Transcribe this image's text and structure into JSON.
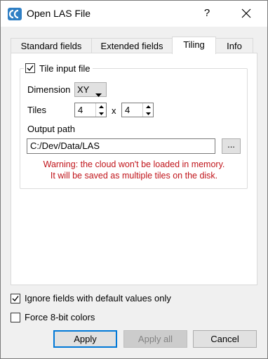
{
  "window": {
    "title": "Open LAS File",
    "help_label": "?"
  },
  "tabs": [
    {
      "label": "Standard fields",
      "active": false
    },
    {
      "label": "Extended fields",
      "active": false
    },
    {
      "label": "Tiling",
      "active": true
    },
    {
      "label": "Info",
      "active": false
    }
  ],
  "tiling": {
    "tile_input_label": "Tile input file",
    "tile_input_checked": true,
    "dimension_label": "Dimension",
    "dimension_value": "XY",
    "tiles_label": "Tiles",
    "tiles_x": "4",
    "tiles_separator": "x",
    "tiles_y": "4",
    "output_path_label": "Output path",
    "output_path_value": "C:/Dev/Data/LAS",
    "browse_label": "...",
    "warning_line1": "Warning: the cloud won't be loaded in memory.",
    "warning_line2": "It will be saved as multiple tiles on the disk."
  },
  "options": {
    "ignore_default_label": "Ignore fields with default values only",
    "ignore_default_checked": true,
    "force_8bit_label": "Force 8-bit colors",
    "force_8bit_checked": false
  },
  "buttons": {
    "apply": "Apply",
    "apply_all": "Apply all",
    "cancel": "Cancel"
  },
  "colors": {
    "accent": "#0078d7",
    "warning": "#c0141a",
    "app_icon": "#2f7fc4"
  }
}
